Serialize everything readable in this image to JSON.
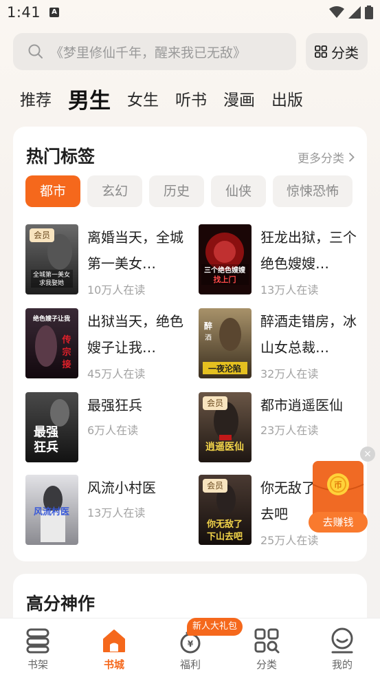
{
  "status": {
    "time": "1:41"
  },
  "search": {
    "placeholder": "《梦里修仙千年，醒来我已无敌》",
    "category_label": "分类"
  },
  "channels": [
    "推荐",
    "男生",
    "女生",
    "听书",
    "漫画",
    "出版"
  ],
  "active_channel": "男生",
  "hot_tags": {
    "title": "热门标签",
    "more_label": "更多分类",
    "tags": [
      "都市",
      "玄幻",
      "历史",
      "仙侠",
      "惊悚恐怖"
    ],
    "active_tag": "都市"
  },
  "books": [
    {
      "title": "离婚当天，全城第一美女…",
      "readers": "10万人在读",
      "vip": "会员",
      "cover_text": "全城第一美女求我娶她",
      "cover_color": "#3a3a3a"
    },
    {
      "title": "狂龙出狱，三个绝色嫂嫂…",
      "readers": "13万人在读",
      "vip": "",
      "cover_text": "三个绝色嫂嫂找上门",
      "cover_color": "#5a1010"
    },
    {
      "title": "出狱当天，绝色嫂子让我…",
      "readers": "45万人在读",
      "vip": "",
      "cover_text": "绝色嫂子让我传宗接代",
      "cover_color": "#2a1a22"
    },
    {
      "title": "醉酒走错房，冰山女总裁…",
      "readers": "32万人在读",
      "vip": "",
      "cover_text": "醉酒走错房 一夜沦陷",
      "cover_color": "#6b5a3a"
    },
    {
      "title": "最强狂兵",
      "readers": "6万人在读",
      "vip": "",
      "cover_text": "最强狂兵",
      "cover_color": "#2b2b2b"
    },
    {
      "title": "都市逍遥医仙",
      "readers": "23万人在读",
      "vip": "会员",
      "cover_text": "逍遥医仙",
      "cover_color": "#3b2a22"
    },
    {
      "title": "风流小村医",
      "readers": "13万人在读",
      "vip": "",
      "cover_text": "风流村医",
      "cover_color": "#b9b9bd"
    },
    {
      "title": "你无敌了，下山去吧",
      "readers": "25万人在读",
      "vip": "会员",
      "cover_text": "你无敌了下山去吧",
      "cover_color": "#2a1e1a"
    }
  ],
  "section2": {
    "title": "高分神作"
  },
  "earn": {
    "label": "去赚钱",
    "close": "×"
  },
  "nav": {
    "items": [
      "书架",
      "书城",
      "福利",
      "分类",
      "我的"
    ],
    "active": "书城",
    "gift_badge": "新人大礼包"
  },
  "colors": {
    "accent": "#f5681c",
    "tag_bg": "#f3f1ef",
    "muted": "#a2a2a2"
  }
}
